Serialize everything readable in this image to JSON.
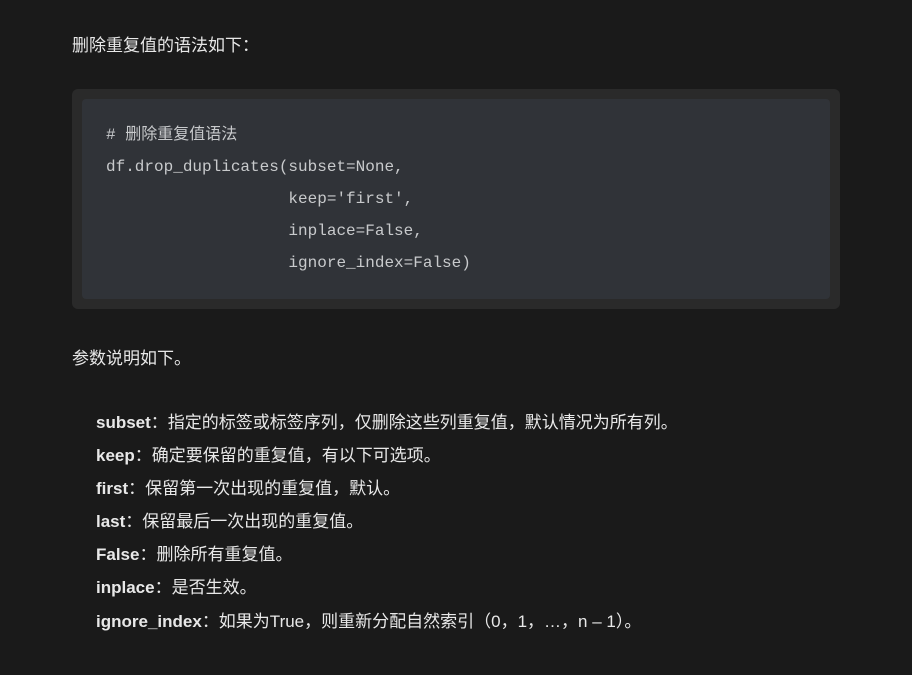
{
  "intro": "删除重复值的语法如下：",
  "code": "# 删除重复值语法\ndf.drop_duplicates(subset=None,\n                   keep='first',\n                   inplace=False,\n                   ignore_index=False)",
  "param_intro": "参数说明如下。",
  "params": [
    {
      "name": "subset",
      "desc": "：指定的标签或标签序列，仅删除这些列重复值，默认情况为所有列。"
    },
    {
      "name": "keep",
      "desc": "：确定要保留的重复值，有以下可选项。"
    },
    {
      "name": "first",
      "desc": "：保留第一次出现的重复值，默认。"
    },
    {
      "name": "last",
      "desc": "：保留最后一次出现的重复值。"
    },
    {
      "name": "False",
      "desc": "：删除所有重复值。"
    },
    {
      "name": "inplace",
      "desc": "：是否生效。"
    },
    {
      "name": "ignore_index",
      "desc": "：如果为True，则重新分配自然索引（0，1，…，n – 1）。"
    }
  ]
}
